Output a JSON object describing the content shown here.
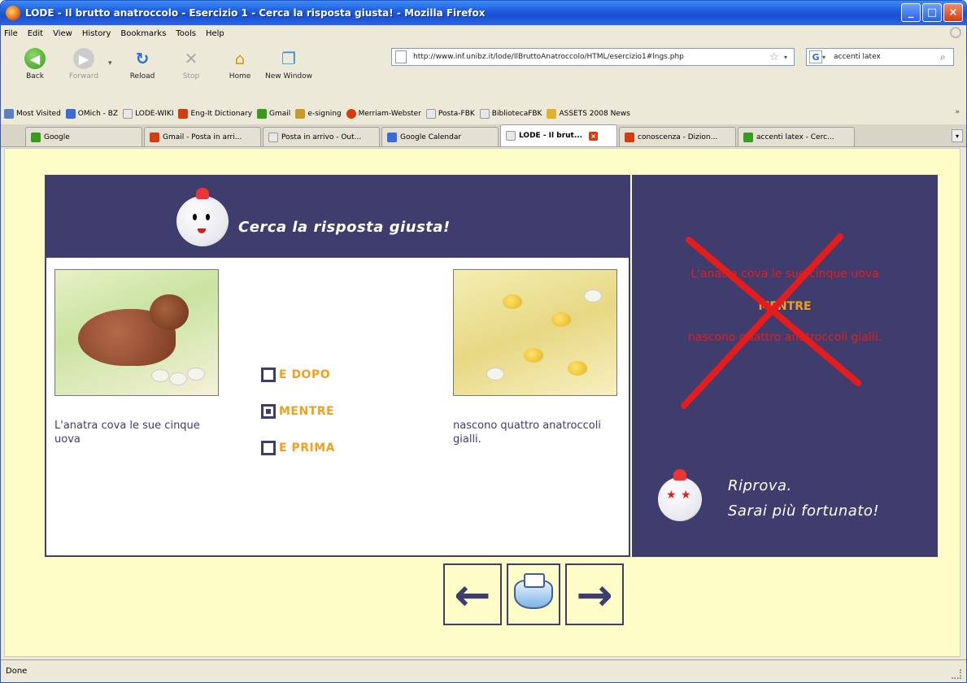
{
  "window": {
    "title": "LODE - Il brutto anatroccolo - Esercizio 1 - Cerca la risposta giusta! - Mozilla Firefox",
    "min": "_",
    "max": "□",
    "close": "×"
  },
  "menu": [
    "File",
    "Edit",
    "View",
    "History",
    "Bookmarks",
    "Tools",
    "Help"
  ],
  "nav": {
    "back": "Back",
    "forward": "Forward",
    "reload": "Reload",
    "stop": "Stop",
    "home": "Home",
    "new_window": "New Window",
    "url": "http://www.inf.unibz.it/lode/IlBruttoAnatroccolo/HTML/esercizio1#lngs.php",
    "search_query": "accenti latex"
  },
  "bookmarks": [
    {
      "label": "Most Visited",
      "color": "#5a7ec8"
    },
    {
      "label": "OMich - BZ",
      "color": "#3a6ad8"
    },
    {
      "label": "LODE-WIKI",
      "color": "#e8e8e8"
    },
    {
      "label": "Eng-It Dictionary",
      "color": "#d43c12"
    },
    {
      "label": "Gmail",
      "color": "#3a9a1d"
    },
    {
      "label": "e-signing",
      "color": "#c89a2a"
    },
    {
      "label": "Merriam-Webster",
      "color": "#d43c12"
    },
    {
      "label": "Posta-FBK",
      "color": "#e8e8e8"
    },
    {
      "label": "BibliotecaFBK",
      "color": "#e8e8e8"
    },
    {
      "label": "ASSETS 2008 News",
      "color": "#e0b030"
    }
  ],
  "bookmarks_more": "»",
  "tabs": [
    {
      "label": "Google",
      "color": "#3a9a1d",
      "active": false
    },
    {
      "label": "Gmail - Posta in arri...",
      "color": "#d43c12",
      "active": false
    },
    {
      "label": "Posta in arrivo - Out...",
      "color": "#e8e8e8",
      "active": false
    },
    {
      "label": "Google Calendar",
      "color": "#3a6ad8",
      "active": false
    },
    {
      "label": "LODE - Il brut...",
      "color": "#e8e8e8",
      "active": true
    },
    {
      "label": "conoscenza - Dizion...",
      "color": "#d43c12",
      "active": false
    },
    {
      "label": "accenti latex - Cerc...",
      "color": "#3a9a1d",
      "active": false
    }
  ],
  "lesson": {
    "title": "Cerca la risposta giusta!",
    "left_caption": "L'anatra cova le sue cinque uova",
    "right_caption": "nascono quattro anatroccoli gialli.",
    "options": [
      {
        "label": "E DOPO",
        "checked": false
      },
      {
        "label": "MENTRE",
        "checked": true
      },
      {
        "label": "E PRIMA",
        "checked": false
      }
    ]
  },
  "feedback": {
    "line1": "L'anatra cova le sue cinque uova",
    "connector": "MENTRE",
    "line3": "nascono quattro anatroccoli gialli.",
    "retry1": "Riprova.",
    "retry2": "Sarai più fortunato!"
  },
  "controls": {
    "prev": "←",
    "next": "→"
  },
  "status": "Done",
  "colors": {
    "panel": "#3f3c6e",
    "accent": "#f0a020",
    "error": "#e51c1c",
    "background": "#fefcc7"
  }
}
